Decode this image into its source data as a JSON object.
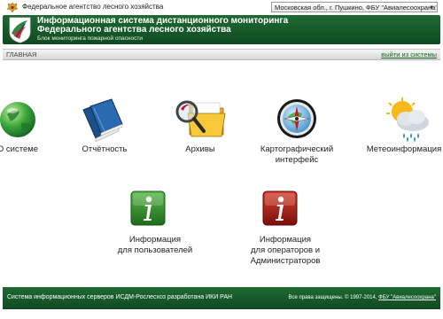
{
  "topbar": {
    "agency_name": "Федеральное агентство лесного хозяйства",
    "region_select": "Московская обл., г. Пушкино, ФБУ \"Авиалесоохрана\""
  },
  "header": {
    "title_line1": "Информационная система дистанционного мониторинга",
    "title_line2": "Федерального агентства лесного хозяйства",
    "subtitle": "Блок мониторинга пожарной опасности"
  },
  "nav": {
    "home_label": "ГЛАВНАЯ",
    "exit_label": "выйти из системы"
  },
  "tiles": [
    {
      "label": "О системе",
      "icon": "globe-icon"
    },
    {
      "label": "Отчётность",
      "icon": "books-icon"
    },
    {
      "label": "Архивы",
      "icon": "folder-magnifier-icon"
    },
    {
      "label_line1": "Картографический",
      "label_line2": "интерфейс",
      "icon": "compass-icon"
    },
    {
      "label": "Метеоинформация",
      "icon": "weather-icon"
    },
    {
      "label_line1": "Информация",
      "label_line2": "для пользователей",
      "icon": "info-green-icon"
    },
    {
      "label_line1": "Информация",
      "label_line2": "для операторов и",
      "label_line3": "Администраторов",
      "icon": "info-red-icon"
    }
  ],
  "footer": {
    "left_text": "Система информационных серверов ИСДМ-Рослесхоз разработана ИКИ РАН",
    "rights_text": "Все права защищены. © 1997-2014,",
    "org_link": "ФБУ \"Авиалесоохрана\""
  },
  "colors": {
    "header_green": "#1a5e2c",
    "link_green": "#1a6a22",
    "info_green": "#2f8a2a",
    "info_red": "#a51a14"
  }
}
